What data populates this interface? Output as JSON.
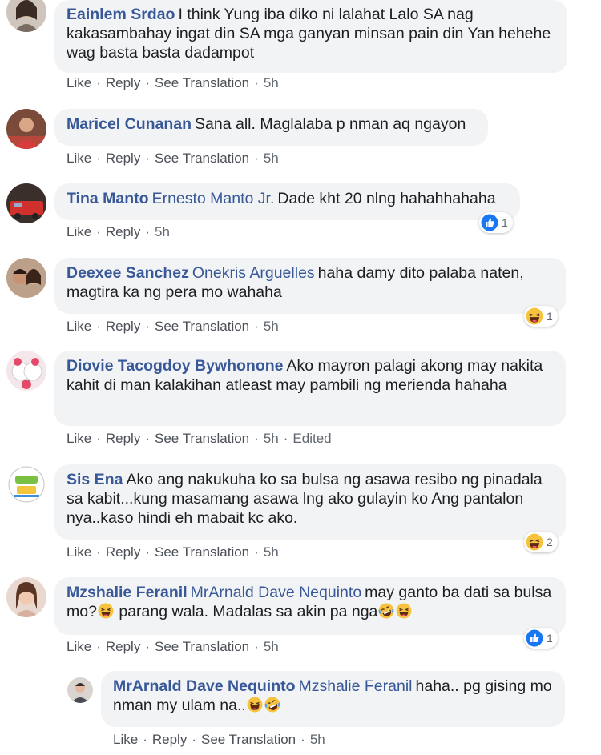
{
  "actions": {
    "like": "Like",
    "reply": "Reply",
    "see_translation": "See Translation",
    "dot": "·"
  },
  "comments": [
    {
      "author": "Eainlem Srdao",
      "text": "I think Yung iba diko ni lalahat Lalo SA nag kakasambahay ingat din SA mga ganyan minsan pain din Yan hehehe wag basta basta dadampot",
      "time": "5h"
    },
    {
      "author": "Maricel Cunanan",
      "text": "Sana all. Maglalaba p nman aq ngayon",
      "time": "5h"
    },
    {
      "author": "Tina Manto",
      "tag": "Ernesto Manto Jr.",
      "text": "Dade kht 20 nlng hahahhahaha",
      "time": "5h",
      "reaction": {
        "type": "like-icon",
        "count": "1"
      }
    },
    {
      "author": "Deexee Sanchez",
      "tag": "Onekris Arguelles",
      "text": "haha damy dito palaba naten, magtira ka ng pera mo wahaha",
      "time": "5h",
      "reaction": {
        "type": "haha-icon",
        "count": "1"
      }
    },
    {
      "author": "Diovie Tacogdoy Bywhonone",
      "text": "Ako mayron palagi akong may nakita kahit di man kalakihan atleast may pambili ng merienda hahaha",
      "time": "5h",
      "edited": "Edited"
    },
    {
      "author": "Sis Ena",
      "text": "Ako ang nakukuha ko sa bulsa ng asawa resibo ng pinadala sa kabit...kung masamang asawa lng ako gulayin ko Ang pantalon nya..kaso hindi eh mabait kc ako.",
      "time": "5h",
      "reaction": {
        "type": "haha-icon",
        "count": "2"
      }
    },
    {
      "author": "Mzshalie Feranil",
      "tag": "MrArnald Dave Nequinto",
      "text_1": "may ganto ba dati sa bulsa mo?",
      "text_2": "parang wala. Madalas sa akin pa nga",
      "time": "5h",
      "reaction": {
        "type": "like-icon",
        "count": "1"
      }
    },
    {
      "author": "MrArnald Dave Nequinto",
      "tag": "Mzshalie Feranil",
      "text_1": "haha.. pg gising mo nman my ulam na..",
      "time": "5h"
    }
  ],
  "colors": {
    "author_link": "#385898",
    "bubble_bg": "#f2f3f5",
    "meta_text": "#606770",
    "like_blue": "#1877f2",
    "haha_yellow": "#f7b125"
  }
}
